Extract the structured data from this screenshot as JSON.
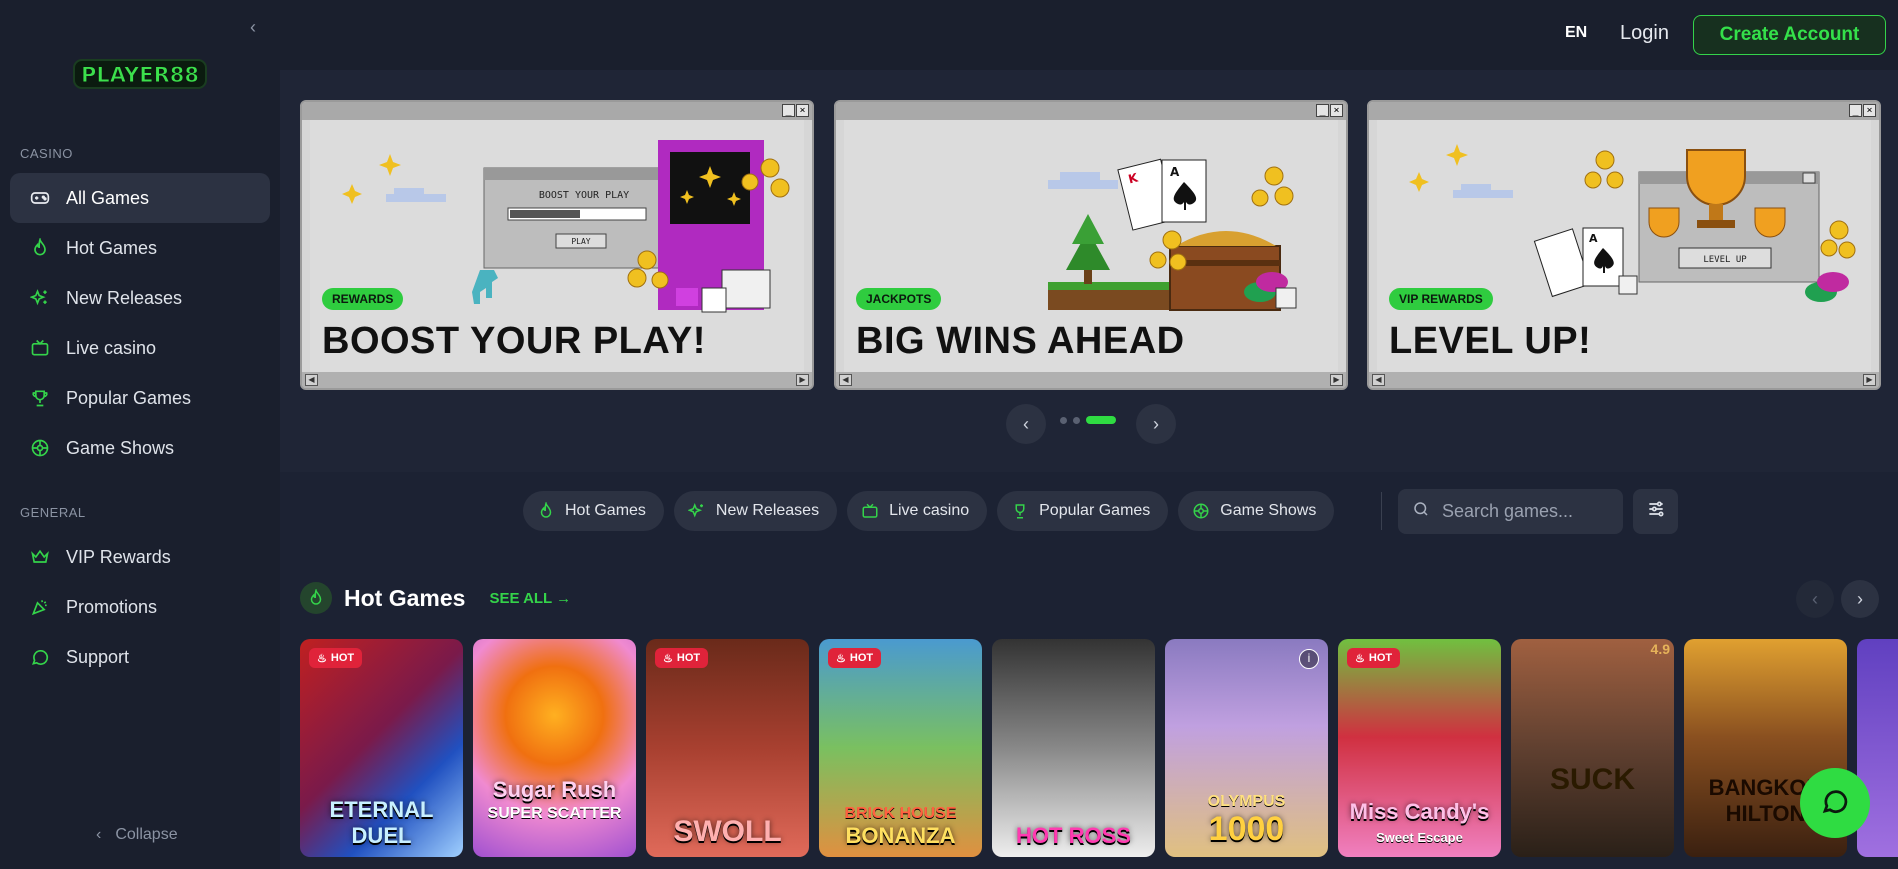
{
  "sidebar": {
    "collapse_icon": "chevron-left-icon",
    "logo_text": "PLAYER88",
    "sections": {
      "casino_label": "CASINO",
      "general_label": "GENERAL"
    },
    "casino_items": [
      {
        "label": "All Games",
        "icon": "gamepad-icon",
        "active": true
      },
      {
        "label": "Hot Games",
        "icon": "flame-icon"
      },
      {
        "label": "New Releases",
        "icon": "sparkles-icon"
      },
      {
        "label": "Live casino",
        "icon": "tv-icon"
      },
      {
        "label": "Popular Games",
        "icon": "trophy-icon"
      },
      {
        "label": "Game Shows",
        "icon": "wheel-icon"
      }
    ],
    "general_items": [
      {
        "label": "VIP Rewards",
        "icon": "crown-icon"
      },
      {
        "label": "Promotions",
        "icon": "party-popper-icon"
      },
      {
        "label": "Support",
        "icon": "chat-icon"
      }
    ],
    "collapse_label": "Collapse"
  },
  "header": {
    "language": "EN",
    "login_label": "Login",
    "create_account_label": "Create Account"
  },
  "banners": [
    {
      "tag": "REWARDS",
      "headline": "BOOST YOUR PLAY!",
      "inner_text": "BOOST YOUR PLAY",
      "button_text": "PLAY"
    },
    {
      "tag": "JACKPOTS",
      "headline": "BIG WINS AHEAD"
    },
    {
      "tag": "VIP REWARDS",
      "headline": "LEVEL UP!",
      "button_text": "LEVEL UP"
    }
  ],
  "carousel": {
    "active_index": 2,
    "count": 3
  },
  "filters": [
    {
      "label": "Hot Games",
      "icon": "flame-icon"
    },
    {
      "label": "New Releases",
      "icon": "sparkles-icon"
    },
    {
      "label": "Live casino",
      "icon": "tv-icon"
    },
    {
      "label": "Popular Games",
      "icon": "trophy-icon"
    },
    {
      "label": "Game Shows",
      "icon": "wheel-icon"
    }
  ],
  "search": {
    "placeholder": "Search games..."
  },
  "hot_games": {
    "title": "Hot Games",
    "see_all": "SEE ALL →",
    "games": [
      {
        "art_title": "ETERNAL DUEL",
        "hot_badge": "HOT"
      },
      {
        "art_title": "Sugar Rush",
        "art_sub": "SUPER SCATTER"
      },
      {
        "art_title": "SWOLL",
        "hot_badge": "HOT"
      },
      {
        "art_title": "BONANZA",
        "art_sub": "BRICK HOUSE",
        "hot_badge": "HOT"
      },
      {
        "art_title": "HOT ROSS"
      },
      {
        "art_title": "1000",
        "art_sub": "OLYMPUS"
      },
      {
        "art_title": "Miss Candy's",
        "art_sub": "Sweet Escape",
        "hot_badge": "HOT"
      },
      {
        "art_title": "SUCK",
        "rating": "4.9"
      },
      {
        "art_title": "BANGKOK HILTON"
      }
    ]
  },
  "colors": {
    "accent": "#34d34a",
    "background": "#1c2233",
    "sidebar": "#1a1f2d",
    "surface": "#2c3242",
    "hot_badge": "#e0233a"
  }
}
